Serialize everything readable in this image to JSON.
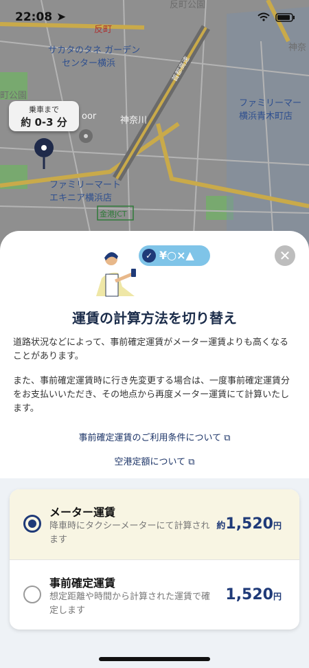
{
  "status_bar": {
    "time": "22:08"
  },
  "map": {
    "labels": [
      "反町公園",
      "反町",
      "サカタのタネ ガーデン",
      "センター横浜",
      "町公園",
      "oor",
      "神奈川",
      "ファミリーマー",
      "横浜青木町店",
      "ファミリーマート",
      "エキニア横浜店",
      "金港JCT",
      "神奈"
    ],
    "eta": {
      "caption": "乗車まで",
      "value": "約 0-3 分"
    },
    "route_label": "首都高速"
  },
  "sheet": {
    "badge_text": "¥○×▲",
    "title": "運賃の計算方法を切り替え",
    "paragraph1": "道路状況などによって、事前確定運賃がメーター運賃よりも高くなることがあります。",
    "paragraph2": "また、事前確定運賃時に行き先変更する場合は、一度事前確定運賃分をお支払いいただき、その地点から再度メーター運賃にて計算いたします。",
    "link_terms": "事前確定運賃のご利用条件について",
    "link_airport": "空港定額について"
  },
  "options": [
    {
      "title": "メーター運賃",
      "desc": "降車時にタクシーメーターにて計算されます",
      "price_prefix": "約",
      "price": "1,520",
      "unit": "円",
      "selected": true
    },
    {
      "title": "事前確定運賃",
      "desc": "想定距離や時間から計算された運賃で確定します",
      "price_prefix": "",
      "price": "1,520",
      "unit": "円",
      "selected": false
    }
  ],
  "colors": {
    "accent": "#1f3a78",
    "selected_bg": "#f8f5e3",
    "badge": "#7fc4e8"
  }
}
